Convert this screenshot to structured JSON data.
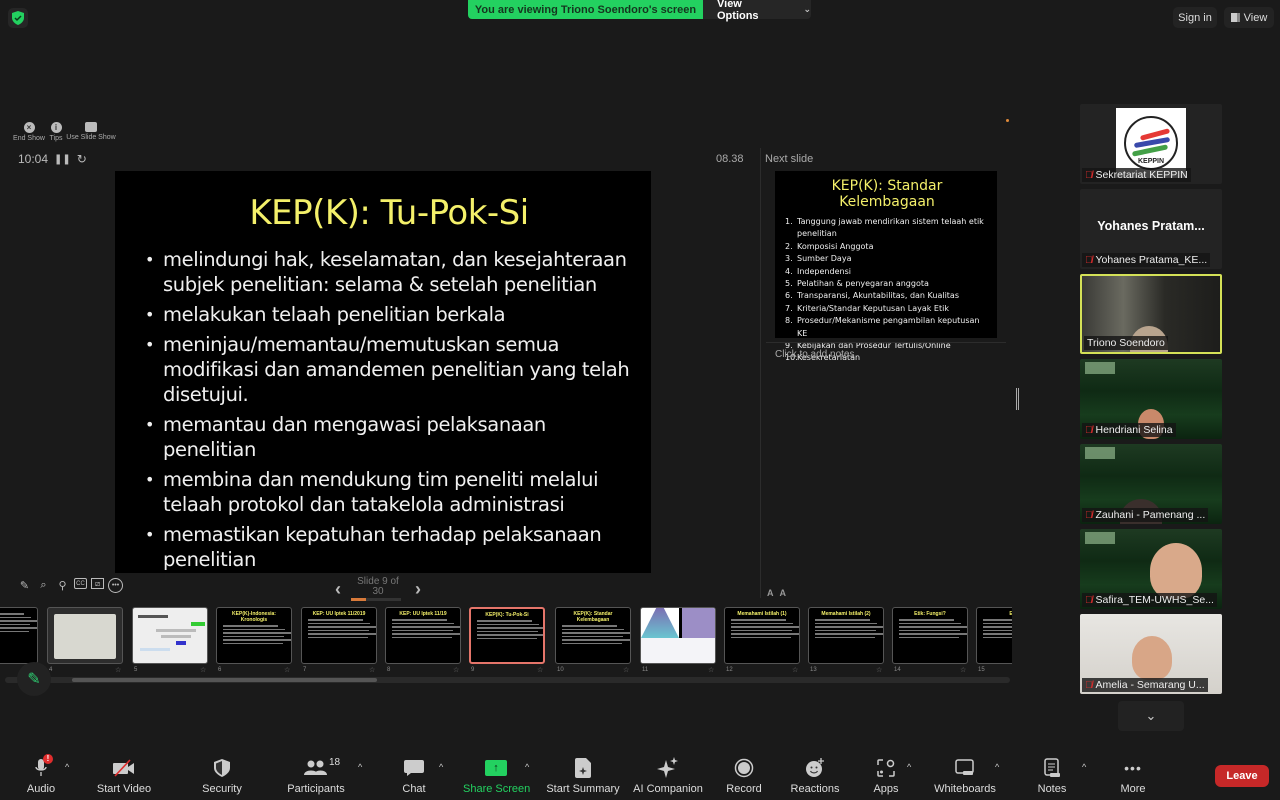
{
  "top": {
    "viewing_banner": "You are viewing Triono Soendoro's screen",
    "view_options": "View Options",
    "sign_in": "Sign in",
    "view": "View"
  },
  "presenter": {
    "controls": [
      {
        "label": "End Show",
        "icon": "close-circle-icon"
      },
      {
        "label": "Tips",
        "icon": "info-icon"
      },
      {
        "label": "Use Slide Show",
        "icon": "slides-icon"
      }
    ],
    "timer": "10:04",
    "elapsed": "08.38",
    "next_slide_label": "Next slide",
    "add_notes": "Click to add notes",
    "font_increase": "A",
    "font_decrease": "A",
    "slide_counter": "Slide 9 of 30",
    "progress": 0.3
  },
  "main_slide": {
    "title": "KEP(K): Tu-Pok-Si",
    "bullets": [
      "melindungi hak, keselamatan, dan kesejahteraan subjek penelitian: selama & setelah penelitian",
      "melakukan telaah penelitian berkala",
      "meninjau/memantau/memutuskan semua modifikasi dan amandemen penelitian yang telah disetujui.",
      "memantau dan mengawasi pelaksanaan penelitian",
      "membina dan mendukung tim peneliti melalui telaah protokol dan tatakelola administrasi",
      "memastikan kepatuhan terhadap pelaksanaan penelitian"
    ]
  },
  "next_slide": {
    "title": "KEP(K): Standar Kelembagaan",
    "items": [
      {
        "n": "1.",
        "text": "Tanggung jawab mendirikan sistem telaah etik penelitian"
      },
      {
        "n": "2.",
        "text": "Komposisi Anggota"
      },
      {
        "n": "3.",
        "text": "Sumber Daya"
      },
      {
        "n": "4.",
        "text": "Independensi"
      },
      {
        "n": "5.",
        "text": "Pelatihan & penyegaran anggota"
      },
      {
        "n": "6.",
        "text": "Transparansi, Akuntabilitas, dan Kualitas"
      },
      {
        "n": "7.",
        "text": "Kriteria/Standar Keputusan Layak Etik"
      },
      {
        "n": "8.",
        "text": "Prosedur/Mekanisme pengambilan keputusan KE"
      },
      {
        "n": "9.",
        "text": "Kebijakan dan Prosedur Tertulis/Online"
      },
      {
        "n": "10.",
        "text": "Kesekretariatan"
      }
    ]
  },
  "thumbnails": [
    {
      "num": "",
      "title": "",
      "style": "dark"
    },
    {
      "num": "4",
      "title": "",
      "style": "photo"
    },
    {
      "num": "5",
      "title": "",
      "style": "light"
    },
    {
      "num": "6",
      "title": "KEP(K)-Indonesia: Kronologis",
      "style": "dark"
    },
    {
      "num": "7",
      "title": "KEP: UU Iptek 11/2019",
      "style": "dark"
    },
    {
      "num": "8",
      "title": "KEP: UU Iptek 11/19",
      "style": "dark"
    },
    {
      "num": "9",
      "title": "KEP(K): Tu-Pok-Si",
      "style": "dark",
      "active": true
    },
    {
      "num": "10",
      "title": "KEP(K): Standar Kelembagaan",
      "style": "dark"
    },
    {
      "num": "11",
      "title": "",
      "style": "diagram"
    },
    {
      "num": "12",
      "title": "Memahami Istilah (1)",
      "style": "dark"
    },
    {
      "num": "13",
      "title": "Memahami Istilah (2)",
      "style": "dark"
    },
    {
      "num": "14",
      "title": "Etik: Fungsi?",
      "style": "dark"
    },
    {
      "num": "15",
      "title": "Etik",
      "style": "dark"
    }
  ],
  "participants": [
    {
      "name": "Sekretariat KEPPIN",
      "type": "logo",
      "logo_text": "KEPPIN",
      "muted": true
    },
    {
      "name": "Yohanes Pratama_KE...",
      "type": "name",
      "display": "Yohanes  Pratam...",
      "muted": true
    },
    {
      "name": "Triono Soendoro",
      "type": "video",
      "active": true,
      "muted": false
    },
    {
      "name": "Hendriani Selina",
      "type": "video",
      "muted": true
    },
    {
      "name": "Zauhani - Pamenang ...",
      "type": "video",
      "muted": true
    },
    {
      "name": "Safira_TEM-UWHS_Se...",
      "type": "video",
      "muted": true
    },
    {
      "name": "Amelia - Semarang U...",
      "type": "video",
      "muted": true
    }
  ],
  "toolbar": {
    "audio": "Audio",
    "start_video": "Start Video",
    "security": "Security",
    "participants": "Participants",
    "participants_count": "18",
    "chat": "Chat",
    "share_screen": "Share Screen",
    "start_summary": "Start Summary",
    "ai_companion": "AI Companion",
    "record": "Record",
    "reactions": "Reactions",
    "apps": "Apps",
    "whiteboards": "Whiteboards",
    "notes": "Notes",
    "more": "More",
    "leave": "Leave",
    "audio_alert": "!"
  },
  "colors": {
    "accent_green": "#23d160",
    "slide_title_yellow": "#f4f06a",
    "leave_red": "#c62828",
    "active_speaker": "#d4e157"
  }
}
